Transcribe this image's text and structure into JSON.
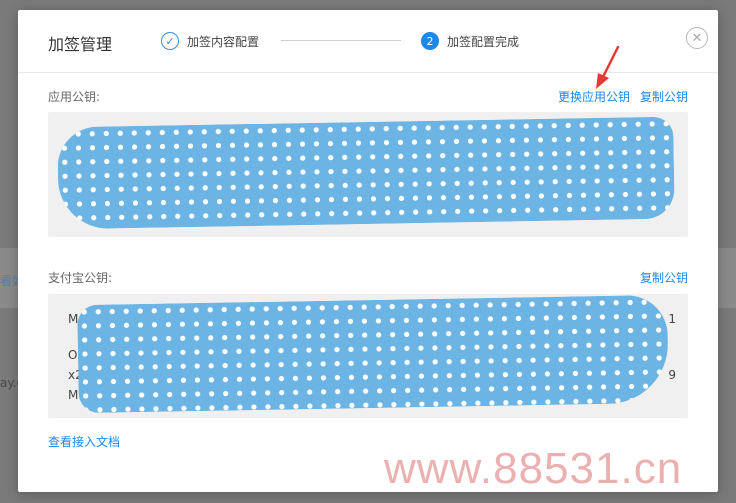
{
  "background": {
    "fragment_left_1": "看如",
    "fragment_left_2": "ay.c"
  },
  "modal": {
    "title": "加签管理",
    "steps": [
      {
        "label": "加签内容配置",
        "state": "done",
        "icon": "✓"
      },
      {
        "label": "加签配置完成",
        "state": "active",
        "icon": "2"
      }
    ],
    "close_icon": "⊗"
  },
  "app_key": {
    "label": "应用公钥:",
    "replace_link": "更换应用公钥",
    "copy_link": "复制公钥",
    "value": "[redacted]"
  },
  "alipay_key": {
    "label": "支付宝公钥:",
    "copy_link": "复制公钥",
    "visible_fragments": [
      "M",
      "Oxs",
      "x2Kl",
      "MRxu"
    ],
    "visible_fragments_right": [
      "1",
      "9"
    ]
  },
  "doc_link": "查看接入文档",
  "watermark": "www.88531.cn",
  "colors": {
    "accent": "#1f87e8",
    "redaction": "#6cb4e4",
    "arrow": "#e53935"
  }
}
